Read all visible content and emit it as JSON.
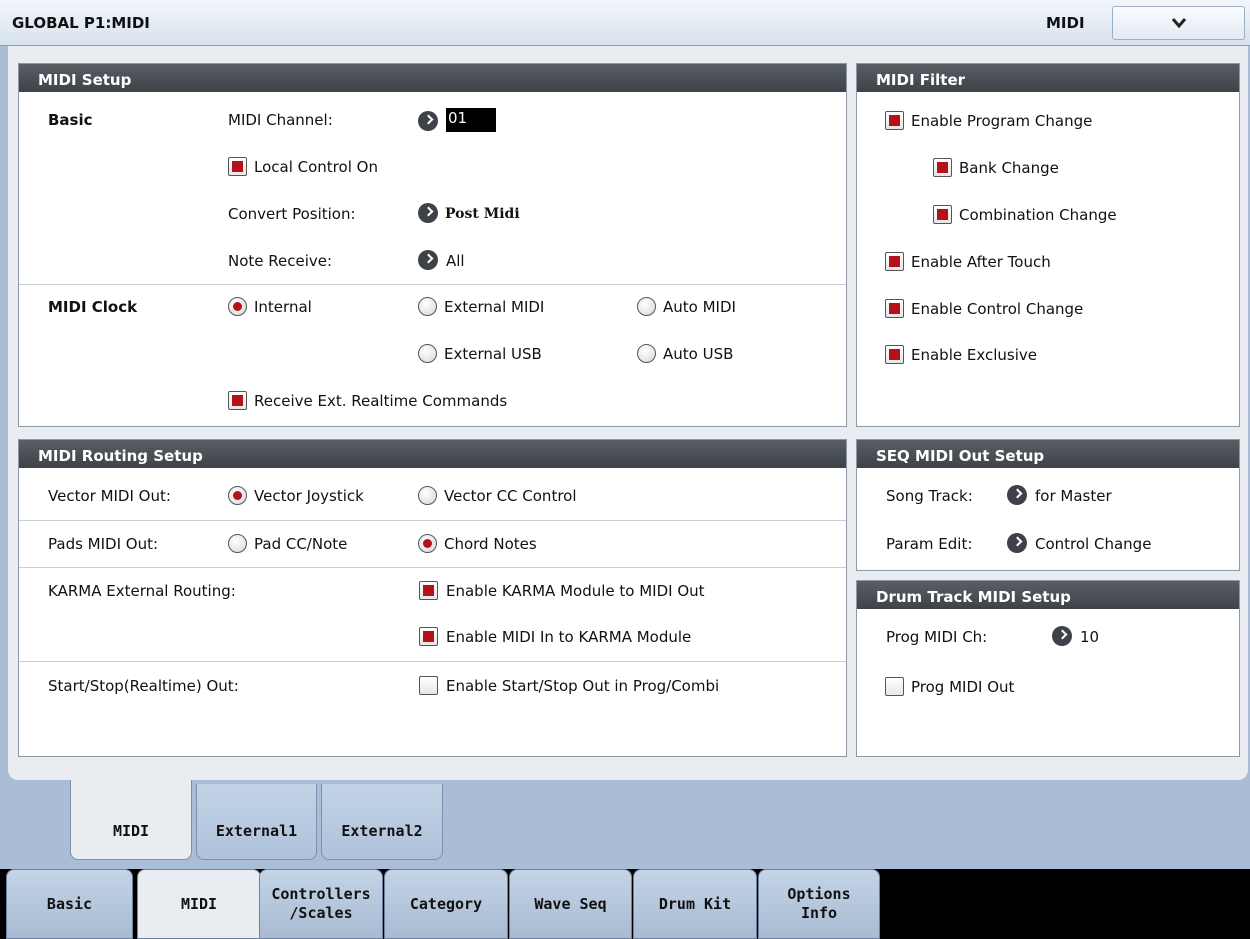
{
  "title": "GLOBAL P1:MIDI",
  "page_menu": {
    "label": "MIDI",
    "icon": "chevron-down-icon"
  },
  "midi_setup": {
    "header": "MIDI Setup",
    "basic_label": "Basic",
    "midi_channel_label": "MIDI Channel:",
    "midi_channel_value": "01",
    "local_control": "Local Control On",
    "convert_position_label": "Convert Position:",
    "convert_position_value": "Post Midi",
    "note_receive_label": "Note Receive:",
    "note_receive_value": "All",
    "clock_label": "MIDI Clock",
    "clock_options": [
      "Internal",
      "External MIDI",
      "Auto MIDI",
      "External USB",
      "Auto USB"
    ],
    "clock_selected": "Internal",
    "receive_ext": "Receive Ext. Realtime Commands"
  },
  "midi_filter": {
    "header": "MIDI Filter",
    "items": [
      "Enable Program Change",
      "Bank Change",
      "Combination Change",
      "Enable After Touch",
      "Enable Control Change",
      "Enable Exclusive"
    ]
  },
  "routing": {
    "header": "MIDI Routing Setup",
    "vector_label": "Vector MIDI Out:",
    "vector_options": [
      "Vector Joystick",
      "Vector CC Control"
    ],
    "pads_label": "Pads MIDI Out:",
    "pads_options": [
      "Pad CC/Note",
      "Chord Notes"
    ],
    "karma_label": "KARMA External Routing:",
    "karma_options": [
      "Enable KARMA Module to MIDI Out",
      "Enable MIDI In to KARMA Module"
    ],
    "startstop_label": "Start/Stop(Realtime) Out:",
    "startstop_option": "Enable Start/Stop Out in Prog/Combi"
  },
  "seq_out": {
    "header": "SEQ MIDI Out Setup",
    "song_track_label": "Song Track:",
    "song_track_value": "for Master",
    "param_edit_label": "Param Edit:",
    "param_edit_value": "Control Change"
  },
  "drum_track": {
    "header": "Drum Track MIDI Setup",
    "prog_ch_label": "Prog MIDI Ch:",
    "prog_ch_value": "10",
    "prog_out": "Prog MIDI Out"
  },
  "sub_tabs": [
    "MIDI",
    "External1",
    "External2"
  ],
  "page_tabs": [
    {
      "l1": "Basic",
      "l2": ""
    },
    {
      "l1": "MIDI",
      "l2": ""
    },
    {
      "l1": "Controllers",
      "l2": "/Scales"
    },
    {
      "l1": "Category",
      "l2": ""
    },
    {
      "l1": "Wave Seq",
      "l2": ""
    },
    {
      "l1": "Drum Kit",
      "l2": ""
    },
    {
      "l1": "Options",
      "l2": "Info"
    }
  ]
}
